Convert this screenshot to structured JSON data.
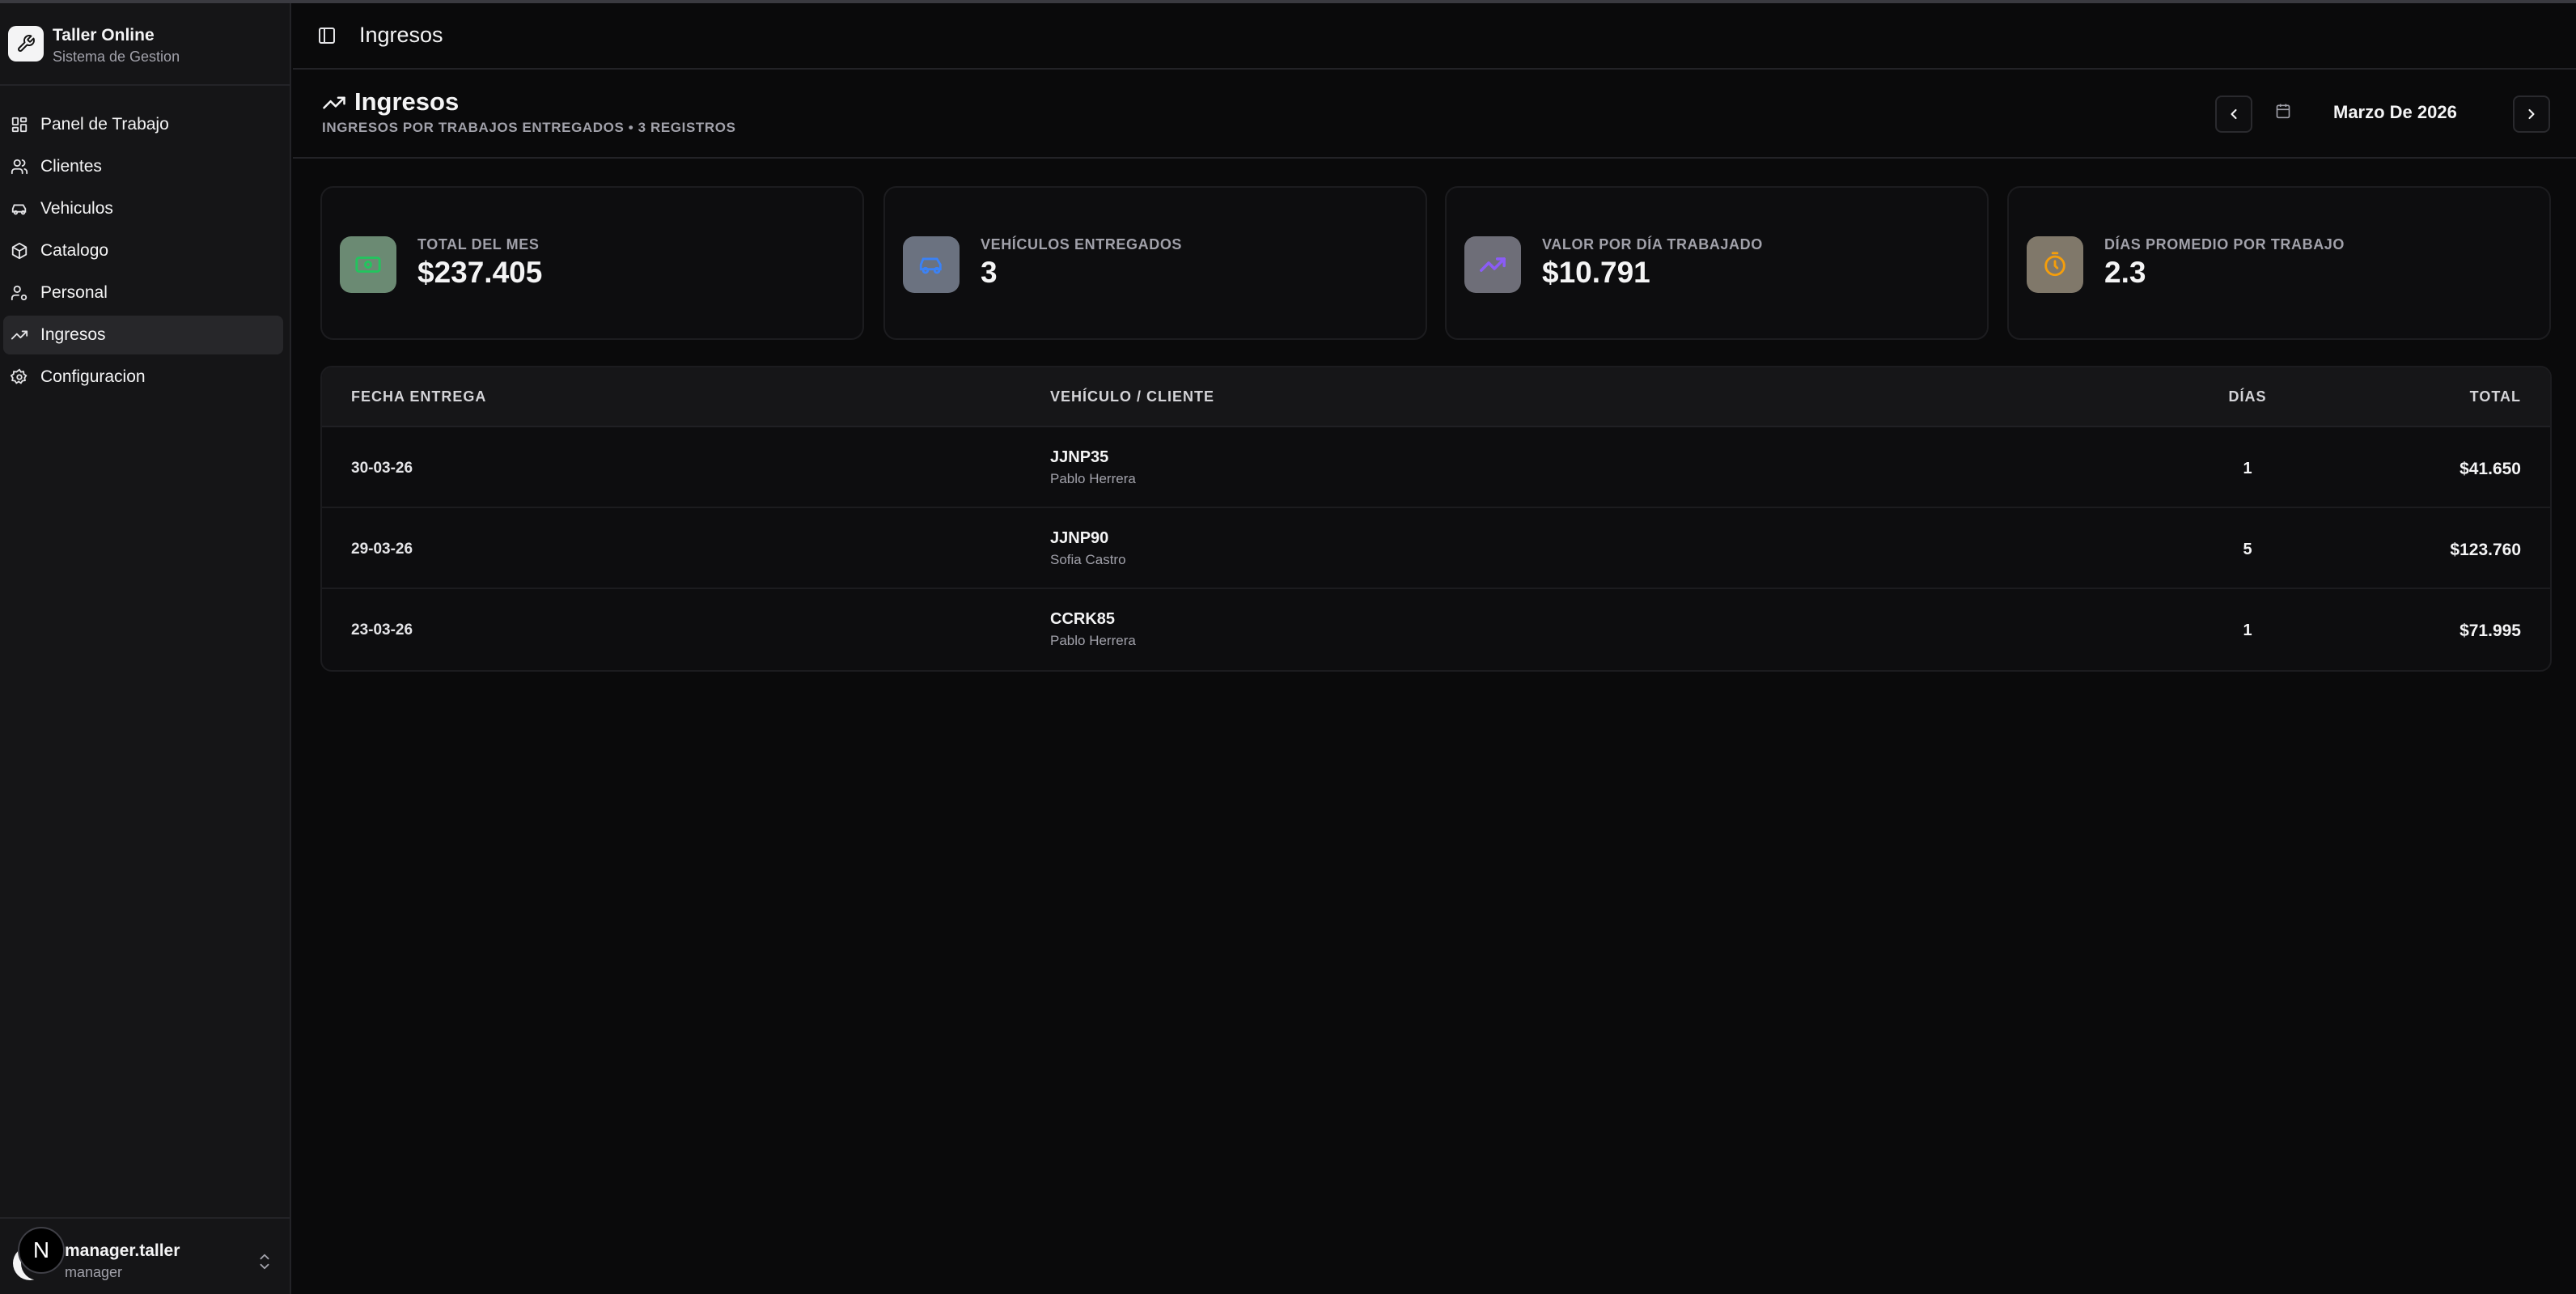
{
  "app": {
    "name": "Taller Online",
    "subtitle": "Sistema de Gestion"
  },
  "sidebar": {
    "items": [
      {
        "label": "Panel de Trabajo",
        "icon": "layout-grid-icon"
      },
      {
        "label": "Clientes",
        "icon": "users-icon"
      },
      {
        "label": "Vehiculos",
        "icon": "car-icon"
      },
      {
        "label": "Catalogo",
        "icon": "package-icon"
      },
      {
        "label": "Personal",
        "icon": "user-cog-icon"
      },
      {
        "label": "Ingresos",
        "icon": "trending-up-icon",
        "active": true
      },
      {
        "label": "Configuracion",
        "icon": "settings-icon"
      }
    ],
    "user": {
      "name": "manager.taller",
      "role": "manager",
      "badge": "N"
    }
  },
  "topbar": {
    "title": "Ingresos"
  },
  "header": {
    "title": "Ingresos",
    "subtitle": "INGRESOS POR TRABAJOS ENTREGADOS • 3 REGISTROS",
    "month": "Marzo De 2026"
  },
  "stats": [
    {
      "label": "Total del mes",
      "value": "$237.405",
      "icon": "money-icon",
      "color": "#4ade80",
      "bg": "#6b8a73"
    },
    {
      "label": "Vehículos entregados",
      "value": "3",
      "icon": "car-icon",
      "color": "#3b82f6",
      "bg": "#6b7280"
    },
    {
      "label": "Valor por día trabajado",
      "value": "$10.791",
      "icon": "trending-up-icon",
      "color": "#8b5cf6",
      "bg": "#6e6e78"
    },
    {
      "label": "Días promedio por trabajo",
      "value": "2.3",
      "icon": "clock-icon",
      "color": "#f59e0b",
      "bg": "#80786a"
    }
  ],
  "table": {
    "columns": [
      "FECHA ENTREGA",
      "VEHÍCULO / CLIENTE",
      "DÍAS",
      "TOTAL"
    ],
    "rows": [
      {
        "date": "30-03-26",
        "plate": "JJNP35",
        "client": "Pablo Herrera",
        "days": "1",
        "total": "$41.650"
      },
      {
        "date": "29-03-26",
        "plate": "JJNP90",
        "client": "Sofia Castro",
        "days": "5",
        "total": "$123.760"
      },
      {
        "date": "23-03-26",
        "plate": "CCRK85",
        "client": "Pablo Herrera",
        "days": "1",
        "total": "$71.995"
      }
    ]
  }
}
